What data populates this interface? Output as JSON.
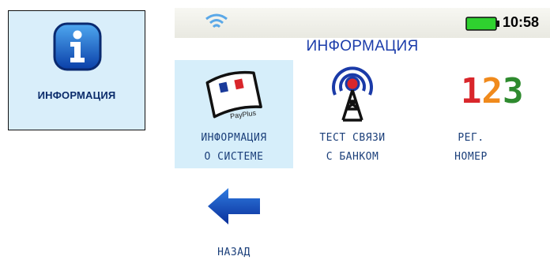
{
  "left_card": {
    "label": "ИНФОРМАЦИЯ",
    "icon": "info-icon"
  },
  "status_bar": {
    "wifi_icon": "wifi-icon",
    "battery_icon": "battery-icon",
    "time": "10:58"
  },
  "screen": {
    "title": "ИНФОРМАЦИЯ",
    "tiles": [
      {
        "icon": "payplus-card-icon",
        "brand": "PayPlus",
        "line1": "ИНФОРМАЦИЯ",
        "line2": "О СИСТЕМЕ",
        "selected": true
      },
      {
        "icon": "antenna-tower-icon",
        "line1": "ТЕСТ СВЯЗИ",
        "line2": "С БАНКОМ",
        "selected": false
      },
      {
        "icon": "numbers-123-icon",
        "digits": [
          "1",
          "2",
          "3"
        ],
        "line1": "РЕГ.",
        "line2": "НОМЕР",
        "selected": false
      },
      {
        "icon": "back-arrow-icon",
        "line1": "НАЗАД",
        "selected": false
      }
    ]
  },
  "colors": {
    "title_blue": "#1b3caa",
    "label_blue": "#1b3f7a",
    "selection_bg": "#d6eefa",
    "battery_green": "#2fd12f",
    "digit_1": "#d9262b",
    "digit_2": "#f08a1c",
    "digit_3": "#2e8a2e"
  }
}
